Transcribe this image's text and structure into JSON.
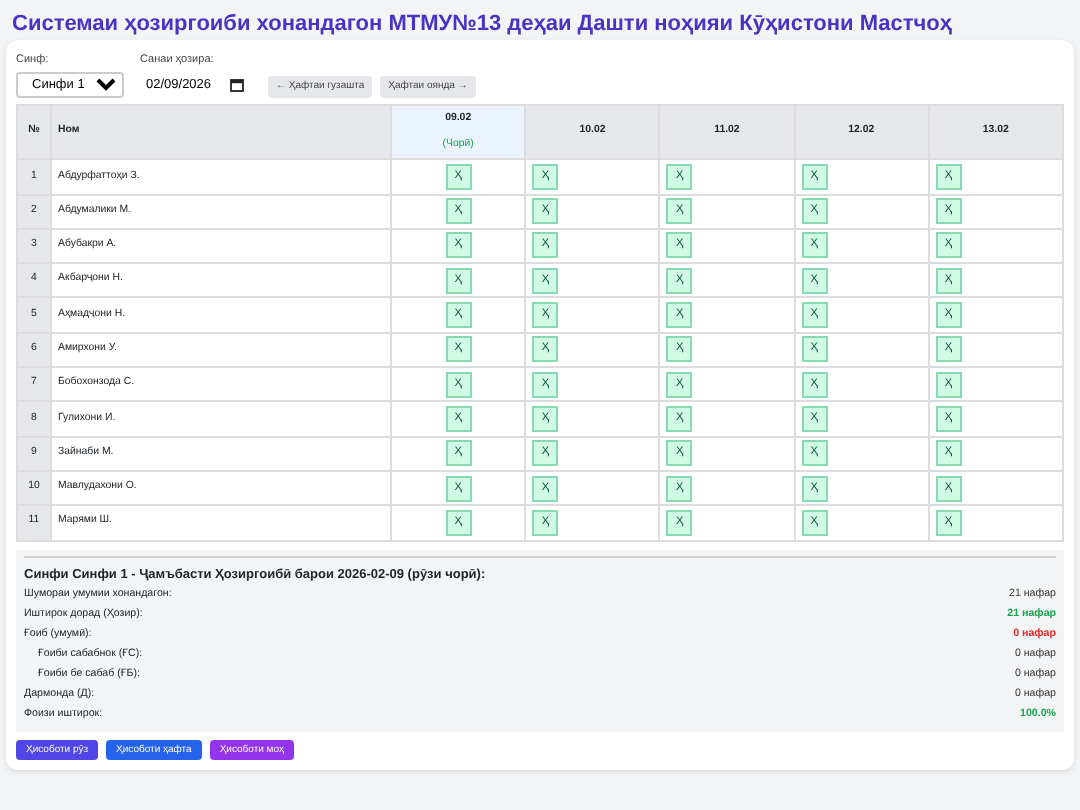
{
  "title": "Системаи ҳозиргоиби хонандагон МТМУ№13 деҳаи Дашти ноҳияи Кӯҳистони Мастчоҳ",
  "controls": {
    "class_label": "Синф:",
    "class_value": "Синфи 1",
    "date_label": "Санаи ҳозира:",
    "date_value": "02/09/2026",
    "prev_week": "← Ҳафтаи гузашта",
    "next_week": "Ҳафтаи оянда →"
  },
  "table": {
    "columns": [
      "№",
      "Ном"
    ],
    "days": [
      {
        "date": "09.02",
        "note": "(Чорӣ)",
        "selected": true
      },
      {
        "date": "10.02",
        "selected": false
      },
      {
        "date": "11.02",
        "selected": false
      },
      {
        "date": "12.02",
        "selected": false
      },
      {
        "date": "13.02",
        "selected": false
      }
    ],
    "rows": [
      {
        "num": "1",
        "name": "Абдурфаттоҳи З.",
        "marks": [
          {
            "text": "Ҳ",
            "kind": "present"
          },
          {
            "text": "Ҳ",
            "kind": "present"
          },
          {
            "text": "Ҳ",
            "kind": "present"
          },
          {
            "text": "Ҳ",
            "kind": "present"
          },
          {
            "text": "Ҳ",
            "kind": "present"
          }
        ]
      },
      {
        "num": "2",
        "name": "Абдумалики М.",
        "marks": [
          {
            "text": "Ҳ",
            "kind": "present"
          },
          {
            "text": "Ҳ",
            "kind": "present"
          },
          {
            "text": "Ҳ",
            "kind": "present"
          },
          {
            "text": "Ҳ",
            "kind": "present"
          },
          {
            "text": "Ҳ",
            "kind": "present"
          }
        ]
      },
      {
        "num": "3",
        "name": "Абубакри А.",
        "marks": [
          {
            "text": "Ҳ",
            "kind": "present"
          },
          {
            "text": "Ҳ",
            "kind": "present"
          },
          {
            "text": "Ҳ",
            "kind": "present"
          },
          {
            "text": "Ҳ",
            "kind": "present"
          },
          {
            "text": "Ҳ",
            "kind": "present"
          }
        ]
      },
      {
        "num": "4",
        "name": "Акбарҷони Н.",
        "marks": [
          {
            "text": "Ҳ",
            "kind": "present"
          },
          {
            "text": "Ҳ",
            "kind": "present"
          },
          {
            "text": "Ҳ",
            "kind": "present"
          },
          {
            "text": "Ҳ",
            "kind": "present"
          },
          {
            "text": "Ҳ",
            "kind": "present"
          }
        ]
      },
      {
        "num": "5",
        "name": "Аҳмадҷони Н.",
        "marks": [
          {
            "text": "Ҳ",
            "kind": "present"
          },
          {
            "text": "Ҳ",
            "kind": "present"
          },
          {
            "text": "Ҳ",
            "kind": "present"
          },
          {
            "text": "Ҳ",
            "kind": "present"
          },
          {
            "text": "Ҳ",
            "kind": "present"
          }
        ]
      },
      {
        "num": "6",
        "name": "Амирхони У.",
        "marks": [
          {
            "text": "Ҳ",
            "kind": "present"
          },
          {
            "text": "Ҳ",
            "kind": "present"
          },
          {
            "text": "Ҳ",
            "kind": "present"
          },
          {
            "text": "Ҳ",
            "kind": "present"
          },
          {
            "text": "Ҳ",
            "kind": "present"
          }
        ]
      },
      {
        "num": "7",
        "name": "Бобохонзода С.",
        "marks": [
          {
            "text": "Ҳ",
            "kind": "present"
          },
          {
            "text": "Ҳ",
            "kind": "present"
          },
          {
            "text": "Ҳ",
            "kind": "present"
          },
          {
            "text": "Ҳ",
            "kind": "present"
          },
          {
            "text": "Ҳ",
            "kind": "present"
          }
        ]
      },
      {
        "num": "8",
        "name": "Гулихони И.",
        "marks": [
          {
            "text": "Ҳ",
            "kind": "present"
          },
          {
            "text": "Ҳ",
            "kind": "present"
          },
          {
            "text": "Ҳ",
            "kind": "present"
          },
          {
            "text": "Ҳ",
            "kind": "present"
          },
          {
            "text": "Ҳ",
            "kind": "present"
          }
        ]
      },
      {
        "num": "9",
        "name": "Зайнаби М.",
        "marks": [
          {
            "text": "Ҳ",
            "kind": "present"
          },
          {
            "text": "Ҳ",
            "kind": "present"
          },
          {
            "text": "Ҳ",
            "kind": "present"
          },
          {
            "text": "Ҳ",
            "kind": "present"
          },
          {
            "text": "Ҳ",
            "kind": "present"
          }
        ]
      },
      {
        "num": "10",
        "name": "Мавлудахони О.",
        "marks": [
          {
            "text": "Ҳ",
            "kind": "present"
          },
          {
            "text": "Ҳ",
            "kind": "present"
          },
          {
            "text": "Ҳ",
            "kind": "present"
          },
          {
            "text": "Ҳ",
            "kind": "present"
          },
          {
            "text": "Ҳ",
            "kind": "present"
          }
        ]
      },
      {
        "num": "11",
        "name": "Марями Ш.",
        "marks": [
          {
            "text": "Ҳ",
            "kind": "present"
          },
          {
            "text": "Ҳ",
            "kind": "present"
          },
          {
            "text": "Ҳ",
            "kind": "present"
          },
          {
            "text": "Ҳ",
            "kind": "present"
          },
          {
            "text": "Ҳ",
            "kind": "present"
          }
        ]
      }
    ]
  },
  "summary": {
    "heading": "Синфи Синфи 1 - Ҷамъбасти Ҳозиргоибӣ барои 2026-02-09 (рӯзи чорӣ):",
    "items": [
      {
        "label": "Шумораи умумии хонандагон:",
        "value": "21 нафар"
      },
      {
        "label": "Иштирок дорад (Ҳозир):",
        "value": "21 нафар",
        "color": "#16a34a"
      },
      {
        "label": "Ғоиб (умумӣ):",
        "value": "0 нафар",
        "color": "#dc2626",
        "children": [
          {
            "label": "Ғоиби сабабнок (ҒС):",
            "value": "0 нафар"
          },
          {
            "label": "Ғоиби бе сабаб (ҒБ):",
            "value": "0 нафар"
          }
        ]
      },
      {
        "label": "Дармонда (Д):",
        "value": "0 нафар"
      },
      {
        "label": "Фоизи иштирок:",
        "value": "100.0%",
        "color": "#16a34a"
      }
    ]
  },
  "reports": [
    {
      "label": "Ҳисоботи рӯз",
      "kind": "day"
    },
    {
      "label": "Ҳисоботи ҳафта",
      "kind": "week"
    },
    {
      "label": "Ҳисоботи моҳ",
      "kind": "month"
    }
  ]
}
